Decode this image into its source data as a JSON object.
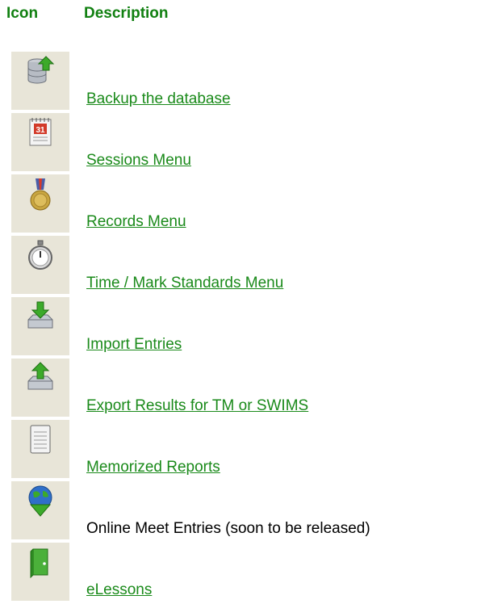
{
  "header": {
    "icon_label": "Icon",
    "description_label": "Description"
  },
  "rows": [
    {
      "icon": "database-upload-icon",
      "label": "Backup the database",
      "link": true
    },
    {
      "icon": "calendar-icon",
      "label": "Sessions Menu",
      "link": true
    },
    {
      "icon": "medal-icon",
      "label": "Records Menu",
      "link": true
    },
    {
      "icon": "stopwatch-icon",
      "label": "Time / Mark Standards Menu",
      "link": true
    },
    {
      "icon": "tray-import-icon",
      "label": "Import Entries",
      "link": true
    },
    {
      "icon": "tray-export-icon",
      "label": "Export Results for TM or SWIMS",
      "link": true
    },
    {
      "icon": "notepad-icon",
      "label": "Memorized Reports",
      "link": true
    },
    {
      "icon": "globe-download-icon",
      "label": "Online Meet Entries (soon to be released)",
      "link": false
    },
    {
      "icon": "book-icon",
      "label": "eLessons",
      "link": true
    }
  ],
  "colors": {
    "header": "#118011",
    "link": "#1a8a1a",
    "icon_bg": "#e8e5d8"
  }
}
